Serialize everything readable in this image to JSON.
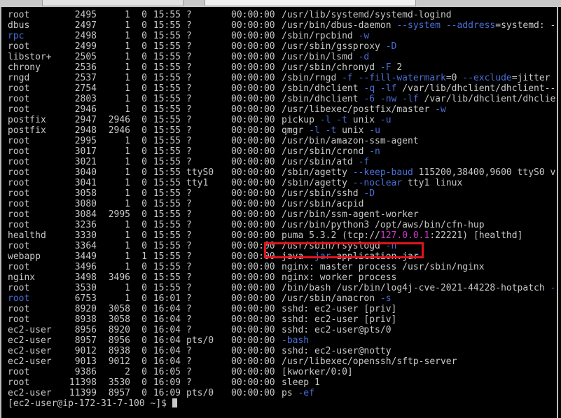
{
  "rows": [
    {
      "user": "root",
      "pid": "2495",
      "ppid": "1",
      "c": "0",
      "stime": "15:55",
      "tty": "?",
      "time": "00:00:00",
      "cmd": [
        {
          "t": "/usr/lib/systemd/systemd-logind"
        }
      ]
    },
    {
      "user": "dbus",
      "pid": "2497",
      "ppid": "1",
      "c": "0",
      "stime": "15:55",
      "tty": "?",
      "time": "00:00:00",
      "cmd": [
        {
          "t": "/usr/bin/dbus-daemon "
        },
        {
          "t": "--system --address",
          "cls": "blue"
        },
        {
          "t": "=systemd: -"
        }
      ]
    },
    {
      "user": "rpc",
      "userCls": "blue",
      "pid": "2498",
      "ppid": "1",
      "c": "0",
      "stime": "15:55",
      "tty": "?",
      "time": "00:00:00",
      "cmd": [
        {
          "t": "/sbin/rpcbind "
        },
        {
          "t": "-w",
          "cls": "blue"
        }
      ]
    },
    {
      "user": "root",
      "pid": "2499",
      "ppid": "1",
      "c": "0",
      "stime": "15:55",
      "tty": "?",
      "time": "00:00:00",
      "cmd": [
        {
          "t": "/usr/sbin/gssproxy "
        },
        {
          "t": "-D",
          "cls": "blue"
        }
      ]
    },
    {
      "user": "libstor+",
      "pid": "2505",
      "ppid": "1",
      "c": "0",
      "stime": "15:55",
      "tty": "?",
      "time": "00:00:00",
      "cmd": [
        {
          "t": "/usr/bin/lsmd "
        },
        {
          "t": "-d",
          "cls": "blue"
        }
      ]
    },
    {
      "user": "chrony",
      "pid": "2536",
      "ppid": "1",
      "c": "0",
      "stime": "15:55",
      "tty": "?",
      "time": "00:00:00",
      "cmd": [
        {
          "t": "/usr/sbin/chronyd "
        },
        {
          "t": "-F",
          "cls": "blue"
        },
        {
          "t": " 2"
        }
      ]
    },
    {
      "user": "rngd",
      "pid": "2537",
      "ppid": "1",
      "c": "0",
      "stime": "15:55",
      "tty": "?",
      "time": "00:00:00",
      "cmd": [
        {
          "t": "/sbin/rngd "
        },
        {
          "t": "-f --fill-watermark",
          "cls": "blue"
        },
        {
          "t": "=0 "
        },
        {
          "t": "--exclude",
          "cls": "blue"
        },
        {
          "t": "=jitter"
        }
      ]
    },
    {
      "user": "root",
      "pid": "2754",
      "ppid": "1",
      "c": "0",
      "stime": "15:55",
      "tty": "?",
      "time": "00:00:00",
      "cmd": [
        {
          "t": "/sbin/dhclient "
        },
        {
          "t": "-q -lf",
          "cls": "blue"
        },
        {
          "t": " /var/lib/dhclient/dhclient--"
        }
      ]
    },
    {
      "user": "root",
      "pid": "2803",
      "ppid": "1",
      "c": "0",
      "stime": "15:55",
      "tty": "?",
      "time": "00:00:00",
      "cmd": [
        {
          "t": "/sbin/dhclient "
        },
        {
          "t": "-6 -nw -lf",
          "cls": "blue"
        },
        {
          "t": " /var/lib/dhclient/dhclie"
        }
      ]
    },
    {
      "user": "root",
      "pid": "2946",
      "ppid": "1",
      "c": "0",
      "stime": "15:55",
      "tty": "?",
      "time": "00:00:00",
      "cmd": [
        {
          "t": "/usr/libexec/postfix/master "
        },
        {
          "t": "-w",
          "cls": "blue"
        }
      ]
    },
    {
      "user": "postfix",
      "pid": "2947",
      "ppid": "2946",
      "c": "0",
      "stime": "15:55",
      "tty": "?",
      "time": "00:00:00",
      "cmd": [
        {
          "t": "pickup "
        },
        {
          "t": "-l -t",
          "cls": "blue"
        },
        {
          "t": " unix "
        },
        {
          "t": "-u",
          "cls": "blue"
        }
      ]
    },
    {
      "user": "postfix",
      "pid": "2948",
      "ppid": "2946",
      "c": "0",
      "stime": "15:55",
      "tty": "?",
      "time": "00:00:00",
      "cmd": [
        {
          "t": "qmgr "
        },
        {
          "t": "-l -t",
          "cls": "blue"
        },
        {
          "t": " unix "
        },
        {
          "t": "-u",
          "cls": "blue"
        }
      ]
    },
    {
      "user": "root",
      "pid": "2995",
      "ppid": "1",
      "c": "0",
      "stime": "15:55",
      "tty": "?",
      "time": "00:00:00",
      "cmd": [
        {
          "t": "/usr/bin/amazon-ssm-agent"
        }
      ]
    },
    {
      "user": "root",
      "pid": "3017",
      "ppid": "1",
      "c": "0",
      "stime": "15:55",
      "tty": "?",
      "time": "00:00:00",
      "cmd": [
        {
          "t": "/usr/sbin/crond "
        },
        {
          "t": "-n",
          "cls": "blue"
        }
      ]
    },
    {
      "user": "root",
      "pid": "3021",
      "ppid": "1",
      "c": "0",
      "stime": "15:55",
      "tty": "?",
      "time": "00:00:00",
      "cmd": [
        {
          "t": "/usr/sbin/atd "
        },
        {
          "t": "-f",
          "cls": "blue"
        }
      ]
    },
    {
      "user": "root",
      "pid": "3040",
      "ppid": "1",
      "c": "0",
      "stime": "15:55",
      "tty": "ttyS0",
      "time": "00:00:00",
      "cmd": [
        {
          "t": "/sbin/agetty "
        },
        {
          "t": "--keep-baud",
          "cls": "blue"
        },
        {
          "t": " 115200,38400,9600 ttyS0 v"
        }
      ]
    },
    {
      "user": "root",
      "pid": "3041",
      "ppid": "1",
      "c": "0",
      "stime": "15:55",
      "tty": "tty1",
      "time": "00:00:00",
      "cmd": [
        {
          "t": "/sbin/agetty "
        },
        {
          "t": "--noclear",
          "cls": "blue"
        },
        {
          "t": " tty1 linux"
        }
      ]
    },
    {
      "user": "root",
      "pid": "3058",
      "ppid": "1",
      "c": "0",
      "stime": "15:55",
      "tty": "?",
      "time": "00:00:00",
      "cmd": [
        {
          "t": "/usr/sbin/sshd "
        },
        {
          "t": "-D",
          "cls": "blue"
        }
      ]
    },
    {
      "user": "root",
      "pid": "3080",
      "ppid": "1",
      "c": "0",
      "stime": "15:55",
      "tty": "?",
      "time": "00:00:00",
      "cmd": [
        {
          "t": "/usr/sbin/acpid"
        }
      ]
    },
    {
      "user": "root",
      "pid": "3084",
      "ppid": "2995",
      "c": "0",
      "stime": "15:55",
      "tty": "?",
      "time": "00:00:00",
      "cmd": [
        {
          "t": "/usr/bin/ssm-agent-worker"
        }
      ]
    },
    {
      "user": "root",
      "pid": "3236",
      "ppid": "1",
      "c": "0",
      "stime": "15:55",
      "tty": "?",
      "time": "00:00:00",
      "cmd": [
        {
          "t": "/usr/bin/python3 /opt/aws/bin/cfn-hup"
        }
      ]
    },
    {
      "user": "healthd",
      "pid": "3330",
      "ppid": "1",
      "c": "0",
      "stime": "15:55",
      "tty": "?",
      "time": "00:00:00",
      "cmd": [
        {
          "t": "puma 5.3.2 (tcp://"
        },
        {
          "t": "127.0.0.1",
          "cls": "magenta"
        },
        {
          "t": ":22221) [healthd]"
        }
      ]
    },
    {
      "user": "root",
      "pid": "3364",
      "ppid": "1",
      "c": "0",
      "stime": "15:55",
      "tty": "?",
      "time": "00:00:00",
      "cmd": [
        {
          "t": "/usr/sbin/rsyslogd "
        },
        {
          "t": "-n",
          "cls": "blue"
        }
      ]
    },
    {
      "user": "webapp",
      "pid": "3449",
      "ppid": "1",
      "c": "1",
      "stime": "15:55",
      "tty": "?",
      "time": "00:00:00",
      "cmd": [
        {
          "t": "java "
        },
        {
          "t": "-jar",
          "cls": "blue"
        },
        {
          "t": " application.jar"
        }
      ]
    },
    {
      "user": "root",
      "pid": "3496",
      "ppid": "1",
      "c": "0",
      "stime": "15:55",
      "tty": "?",
      "time": "00:00:00",
      "cmd": [
        {
          "t": "nginx: master process /usr/sbin/nginx"
        }
      ]
    },
    {
      "user": "nginx",
      "pid": "3498",
      "ppid": "3496",
      "c": "0",
      "stime": "15:55",
      "tty": "?",
      "time": "00:00:00",
      "cmd": [
        {
          "t": "nginx: worker process"
        }
      ]
    },
    {
      "user": "root",
      "pid": "3530",
      "ppid": "1",
      "c": "0",
      "stime": "15:55",
      "tty": "?",
      "time": "00:00:00",
      "cmd": [
        {
          "t": "/bin/bash /usr/bin/log4j-cve-2021-44228-hotpatch "
        },
        {
          "t": "-",
          "cls": "blue"
        }
      ]
    },
    {
      "user": "root",
      "userCls": "blue",
      "pid": "6753",
      "ppid": "1",
      "c": "0",
      "stime": "16:01",
      "tty": "?",
      "time": "00:00:00",
      "cmd": [
        {
          "t": "/usr/sbin/anacron "
        },
        {
          "t": "-s",
          "cls": "blue"
        }
      ]
    },
    {
      "user": "root",
      "pid": "8920",
      "ppid": "3058",
      "c": "0",
      "stime": "16:04",
      "tty": "?",
      "time": "00:00:00",
      "cmd": [
        {
          "t": "sshd: ec2-user [priv]"
        }
      ]
    },
    {
      "user": "root",
      "pid": "8938",
      "ppid": "3058",
      "c": "0",
      "stime": "16:04",
      "tty": "?",
      "time": "00:00:00",
      "cmd": [
        {
          "t": "sshd: ec2-user [priv]"
        }
      ]
    },
    {
      "user": "ec2-user",
      "pid": "8956",
      "ppid": "8920",
      "c": "0",
      "stime": "16:04",
      "tty": "?",
      "time": "00:00:00",
      "cmd": [
        {
          "t": "sshd: ec2-user@pts/0"
        }
      ]
    },
    {
      "user": "ec2-user",
      "pid": "8957",
      "ppid": "8956",
      "c": "0",
      "stime": "16:04",
      "tty": "pts/0",
      "time": "00:00:00",
      "cmd": [
        {
          "t": "-bash",
          "cls": "blue"
        }
      ]
    },
    {
      "user": "ec2-user",
      "pid": "9012",
      "ppid": "8938",
      "c": "0",
      "stime": "16:04",
      "tty": "?",
      "time": "00:00:00",
      "cmd": [
        {
          "t": "sshd: ec2-user@notty"
        }
      ]
    },
    {
      "user": "ec2-user",
      "pid": "9013",
      "ppid": "9012",
      "c": "0",
      "stime": "16:04",
      "tty": "?",
      "time": "00:00:00",
      "cmd": [
        {
          "t": "/usr/libexec/openssh/sftp-server"
        }
      ]
    },
    {
      "user": "root",
      "pid": "9386",
      "ppid": "2",
      "c": "0",
      "stime": "16:05",
      "tty": "?",
      "time": "00:00:00",
      "cmd": [
        {
          "t": "[kworker/0:0]"
        }
      ]
    },
    {
      "user": "root",
      "pid": "11398",
      "ppid": "3530",
      "c": "0",
      "stime": "16:09",
      "tty": "?",
      "time": "00:00:00",
      "cmd": [
        {
          "t": "sleep 1"
        }
      ]
    },
    {
      "user": "ec2-user",
      "pid": "11399",
      "ppid": "8957",
      "c": "0",
      "stime": "16:09",
      "tty": "pts/0",
      "time": "00:00:00",
      "cmd": [
        {
          "t": "ps "
        },
        {
          "t": "-ef",
          "cls": "blue"
        }
      ]
    }
  ],
  "prompt": "[ec2-user@ip-172-31-7-100 ~]$ ",
  "highlight_row_index": 23
}
